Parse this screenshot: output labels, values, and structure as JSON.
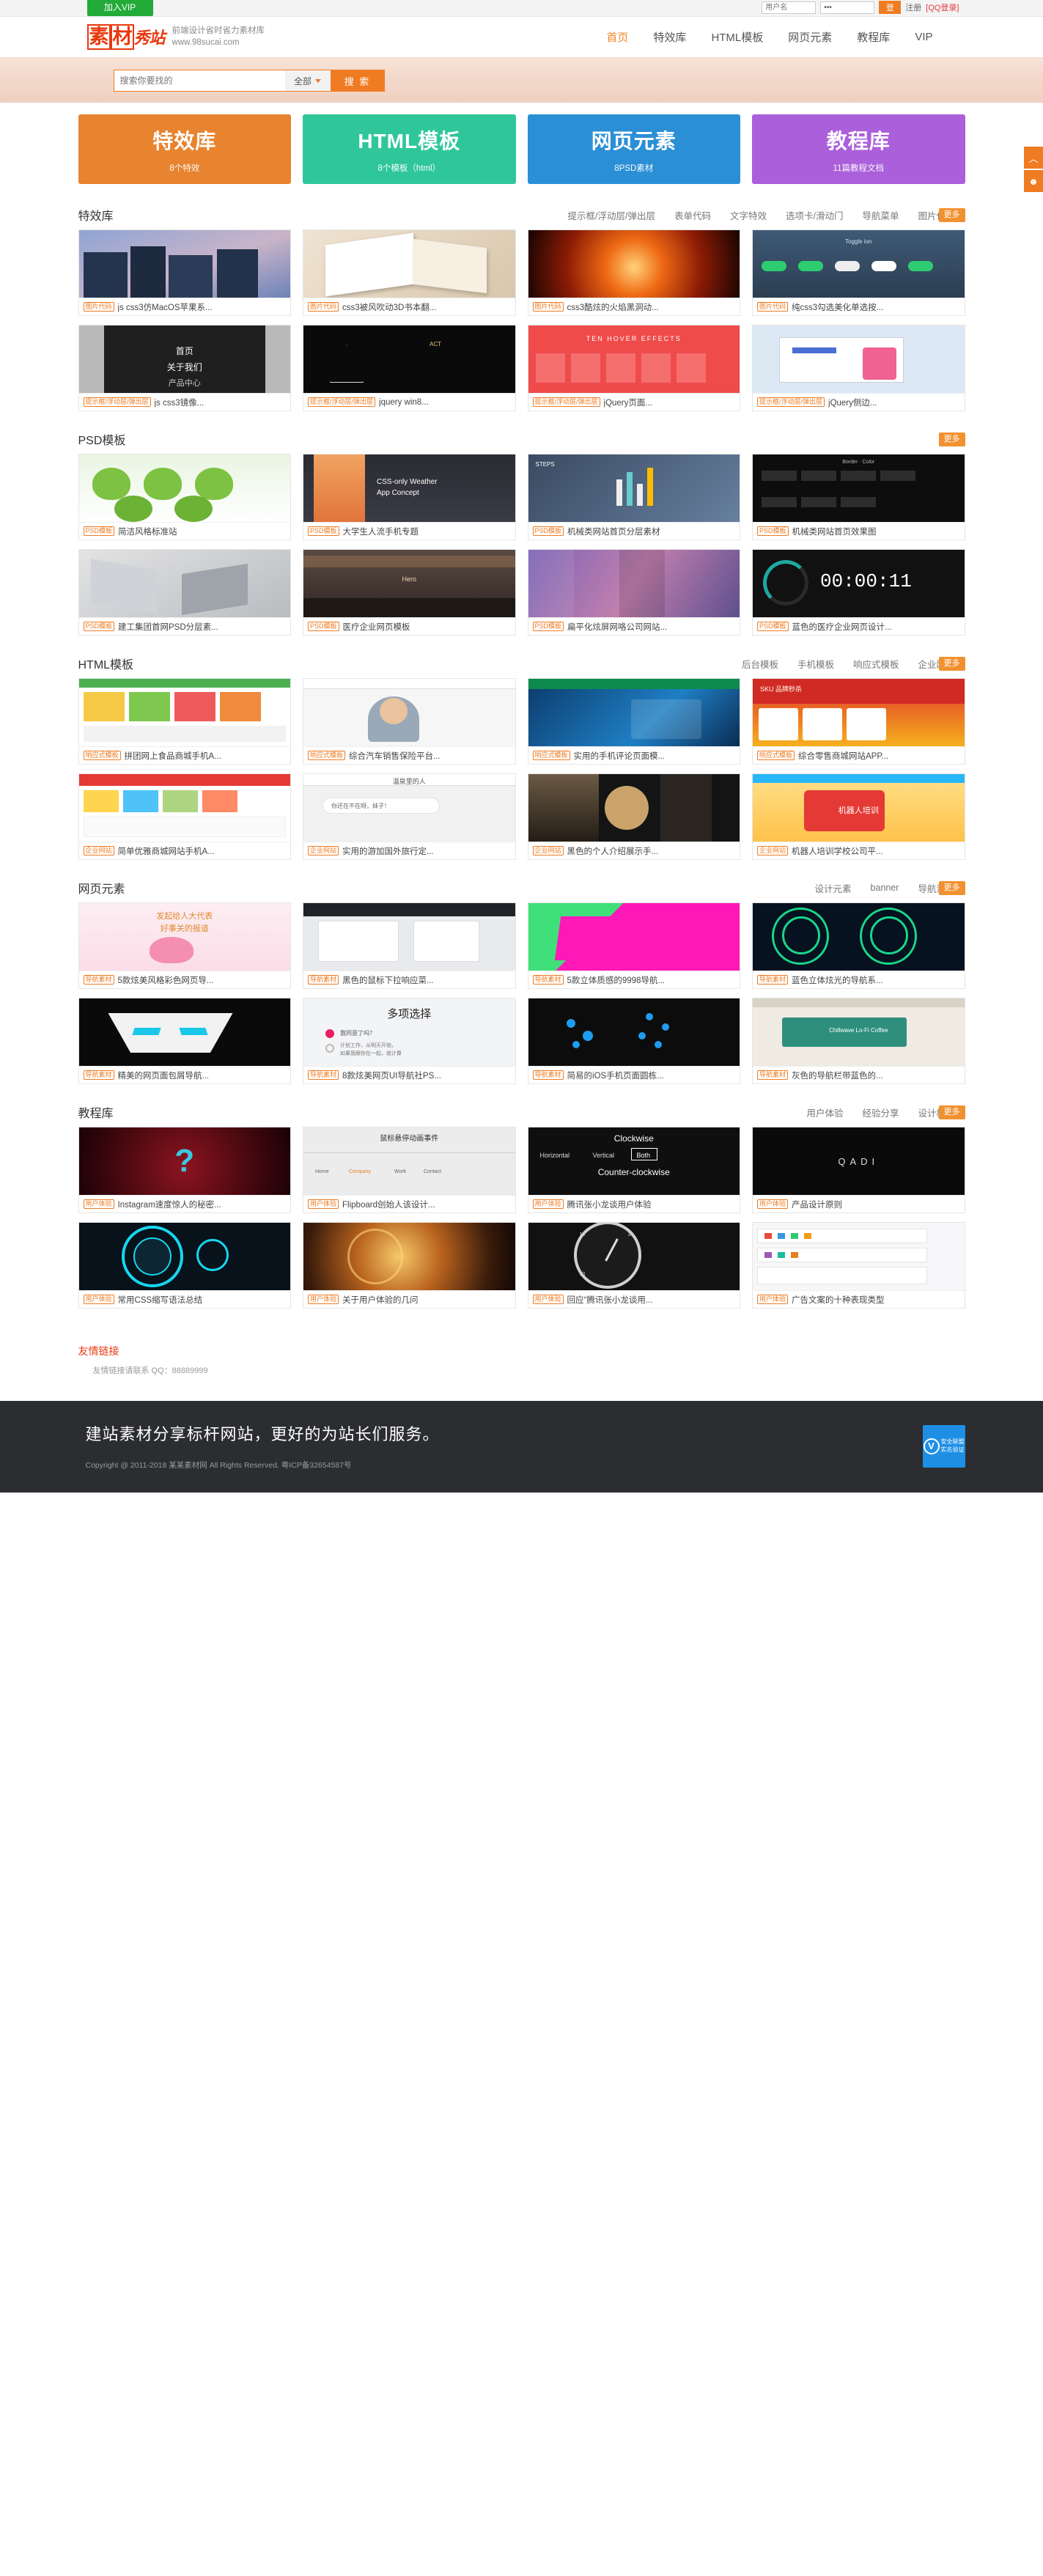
{
  "topbar": {
    "vip_label": "加入VIP",
    "username_placeholder": "用户名",
    "password_value": "•••",
    "login_label": "登",
    "register_label": "注册",
    "qq_login_label": "[QQ登录]"
  },
  "header": {
    "logo_chars": [
      "素",
      "材",
      "秀",
      "站"
    ],
    "tagline": "前端设计省时省力素材库",
    "site_url": "www.98sucai.com",
    "nav": [
      {
        "label": "首页",
        "active": true
      },
      {
        "label": "特效库",
        "active": false
      },
      {
        "label": "HTML模板",
        "active": false
      },
      {
        "label": "网页元素",
        "active": false
      },
      {
        "label": "教程库",
        "active": false
      },
      {
        "label": "VIP",
        "active": false
      }
    ]
  },
  "search": {
    "placeholder": "搜索你要找的",
    "category": "全部",
    "button": "搜 索"
  },
  "dock": [
    {
      "name": "scroll-top-icon",
      "glyph": "︿"
    },
    {
      "name": "user-icon",
      "glyph": "☻"
    }
  ],
  "tiles": [
    {
      "title": "特效库",
      "sub": "8个特效",
      "color": "#e8832f"
    },
    {
      "title": "HTML模板",
      "sub": "8个模板（html）",
      "color": "#2fc79a"
    },
    {
      "title": "网页元素",
      "sub": "8PSD素材",
      "color": "#2b8fd6"
    },
    {
      "title": "教程库",
      "sub": "11篇教程文档",
      "color": "#ab5fdb"
    }
  ],
  "sections": [
    {
      "title": "特效库",
      "links": [
        "提示框/浮动层/弹出层",
        "表单代码",
        "文字特效",
        "选项卡/滑动门",
        "导航菜单",
        "图片代码"
      ],
      "more": "更多",
      "rows": [
        [
          {
            "tag": "图片代码",
            "title": "js css3仿MacOS苹果系...",
            "art": "macos"
          },
          {
            "tag": "图片代码",
            "title": "css3被风吹动3D书本翻...",
            "art": "book"
          },
          {
            "tag": "图片代码",
            "title": "css3酷炫的火焰黑洞动...",
            "art": "fire"
          },
          {
            "tag": "图片代码",
            "title": "纯css3勾选美化单选按...",
            "art": "toggle"
          }
        ],
        [
          {
            "tag": "提示框/浮动层/弹出层",
            "title": "js css3镜像...",
            "art": "mirror"
          },
          {
            "tag": "提示框/浮动层/弹出层",
            "title": "jquery win8...",
            "art": "dark"
          },
          {
            "tag": "提示框/浮动层/弹出层",
            "title": "jQuery页面...",
            "art": "tenhover"
          },
          {
            "tag": "提示框/浮动层/弹出层",
            "title": "jQuery侧边...",
            "art": "sidebar"
          }
        ]
      ]
    },
    {
      "title": "PSD模板",
      "links": [],
      "more": "更多",
      "rows": [
        [
          {
            "tag": "PSD模板",
            "title": "简洁风格标准站",
            "art": "frog"
          },
          {
            "tag": "PSD模板",
            "title": "大学生人流手机专题",
            "art": "weather"
          },
          {
            "tag": "PSD模板",
            "title": "机械类网站首页分层素材",
            "art": "steps"
          },
          {
            "tag": "PSD模板",
            "title": "机械类网站首页效果图",
            "art": "binder"
          }
        ],
        [
          {
            "tag": "PSD模板",
            "title": "建工集团首网PSD分层素...",
            "art": "gray3d"
          },
          {
            "tag": "PSD模板",
            "title": "医疗企业网页模板",
            "art": "medical"
          },
          {
            "tag": "PSD模板",
            "title": "扁平化炫屏网咯公司网站...",
            "art": "purple"
          },
          {
            "tag": "PSD模板",
            "title": "蓝色的医疗企业网页设计...",
            "art": "timer"
          }
        ]
      ]
    },
    {
      "title": "HTML模板",
      "links": [
        "后台模板",
        "手机模板",
        "响应式模板",
        "企业网站"
      ],
      "more": "更多",
      "rows": [
        [
          {
            "tag": "响应式模板",
            "title": "拼团网上食品商城手机A...",
            "art": "food"
          },
          {
            "tag": "响应式模板",
            "title": "综合汽车销售保险平台...",
            "art": "person"
          },
          {
            "tag": "响应式模板",
            "title": "实用的手机评论页面模...",
            "art": "bluetech"
          },
          {
            "tag": "响应式模板",
            "title": "综合零售商城网站APP...",
            "art": "shop"
          }
        ],
        [
          {
            "tag": "企业网站",
            "title": "简单优雅商城网站手机A...",
            "art": "mallui"
          },
          {
            "tag": "企业网站",
            "title": "实用的游加国外旅行定...",
            "art": "chat"
          },
          {
            "tag": "企业网站",
            "title": "黑色的个人介绍展示手...",
            "art": "darkperson"
          },
          {
            "tag": "企业网站",
            "title": "机器人培训学校公司平...",
            "art": "robot"
          }
        ]
      ]
    },
    {
      "title": "网页元素",
      "links": [
        "设计元素",
        "banner",
        "导航素材"
      ],
      "more": "更多",
      "rows": [
        [
          {
            "tag": "导航素材",
            "title": "5款炫美风格彩色网页导...",
            "art": "lotus"
          },
          {
            "tag": "导航素材",
            "title": "黑色的鼠标下拉响应菜...",
            "art": "dropmenu"
          },
          {
            "tag": "导航素材",
            "title": "5款立体质感的9998导航...",
            "art": "magenta"
          },
          {
            "tag": "导航素材",
            "title": "蓝色立体炫光的导航系...",
            "art": "neon"
          }
        ],
        [
          {
            "tag": "导航素材",
            "title": "精美的网页面包屑导航...",
            "art": "mask"
          },
          {
            "tag": "导航素材",
            "title": "8款炫美网页UI导航社PS...",
            "art": "radio"
          },
          {
            "tag": "导航素材",
            "title": "简易的iOS手机页面圆栋...",
            "art": "dots"
          },
          {
            "tag": "导航素材",
            "title": "灰色的导航栏带蓝色的...",
            "art": "coffee"
          }
        ]
      ]
    },
    {
      "title": "教程库",
      "links": [
        "用户体验",
        "经验分享",
        "设计教程"
      ],
      "more": "更多",
      "rows": [
        [
          {
            "tag": "用户体验",
            "title": "Instagram速度惊人的秘密...",
            "art": "question"
          },
          {
            "tag": "用户体验",
            "title": "Flipboard创始人该设计...",
            "art": "hoverdemo"
          },
          {
            "tag": "用户体验",
            "title": "腾讯张小龙谈用户体验",
            "art": "clockwise"
          },
          {
            "tag": "用户体验",
            "title": "产品设计原则",
            "art": "qadi"
          }
        ],
        [
          {
            "tag": "用户体验",
            "title": "常用CSS缩写语法总结",
            "art": "cyan"
          },
          {
            "tag": "用户体验",
            "title": "关于用户体验的几问",
            "art": "spiral"
          },
          {
            "tag": "用户体验",
            "title": "回应“腾讯张小龙谈用...",
            "art": "gauge"
          },
          {
            "tag": "用户体验",
            "title": "广告文案的十种表现类型",
            "art": "icons"
          }
        ]
      ]
    }
  ],
  "friends": {
    "title": "友情链接",
    "note": "友情链接请联系 QQ：88889999"
  },
  "footer": {
    "slogan": "建站素材分享标杆网站，更好的为站长们服务。",
    "copyright": "Copyright @ 2011-2018 某某素材网 All Rights Reserved. 粤ICP备32654587号",
    "cert_line1": "安全联盟",
    "cert_line2": "实名验证",
    "cert_mark": "V"
  },
  "colors": {
    "accent": "#ef7b22",
    "more": "#f2912f",
    "vip_green": "#22ab38",
    "logo_red": "#e8380d",
    "footer_bg": "#2b2d30"
  }
}
